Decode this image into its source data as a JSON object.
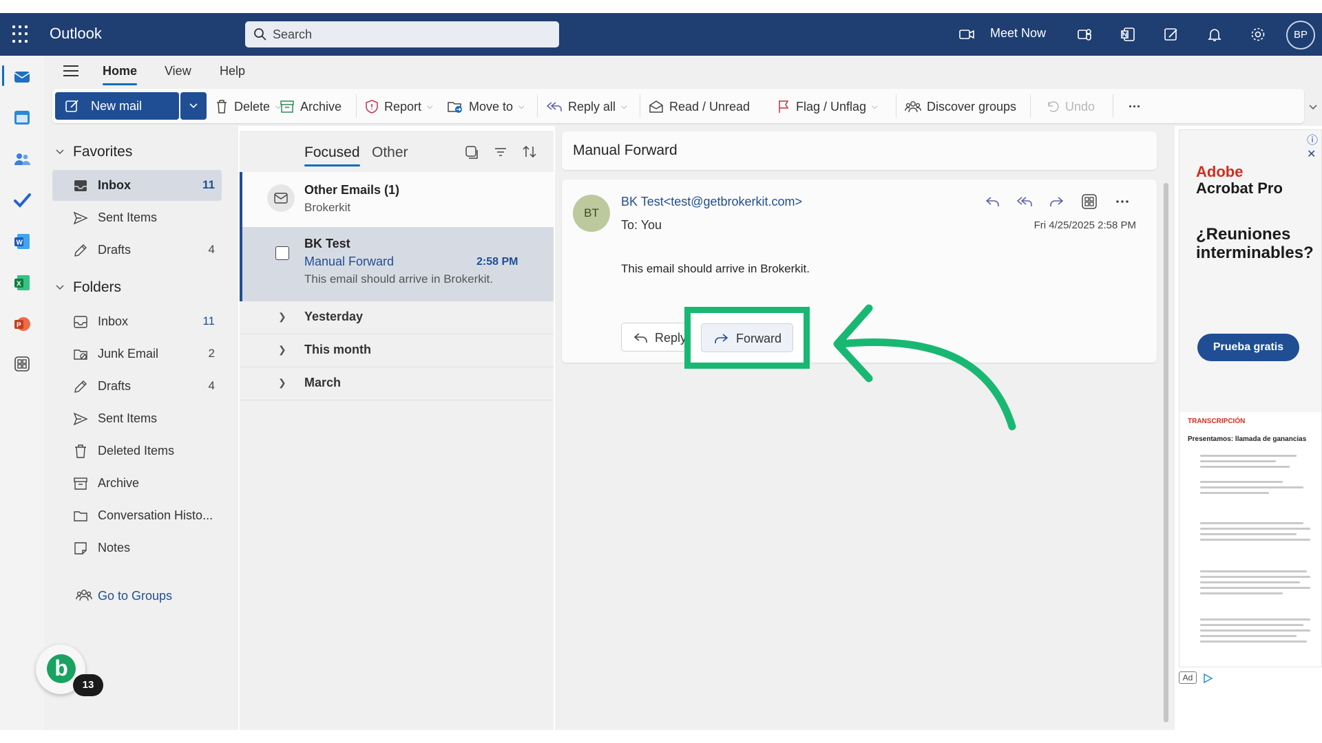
{
  "header": {
    "app_name": "Outlook",
    "search_placeholder": "Search",
    "meet_now": "Meet Now",
    "avatar_initials": "BP"
  },
  "menubar": {
    "tabs": [
      {
        "label": "Home",
        "active": true
      },
      {
        "label": "View",
        "active": false
      },
      {
        "label": "Help",
        "active": false
      }
    ]
  },
  "ribbon": {
    "new_mail": "New mail",
    "delete": "Delete",
    "archive": "Archive",
    "report": "Report",
    "move_to": "Move to",
    "reply_all": "Reply all",
    "read_unread": "Read / Unread",
    "flag_unflag": "Flag / Unflag",
    "discover_groups": "Discover groups",
    "undo": "Undo",
    "more": "···"
  },
  "folders": {
    "favorites_label": "Favorites",
    "favorites": [
      {
        "name": "Inbox",
        "count": "11",
        "icon": "inbox-icon",
        "selected": true
      },
      {
        "name": "Sent Items",
        "count": "",
        "icon": "send-icon",
        "selected": false
      },
      {
        "name": "Drafts",
        "count": "4",
        "icon": "pencil-icon",
        "selected": false
      }
    ],
    "folders_label": "Folders",
    "folders": [
      {
        "name": "Inbox",
        "count": "11",
        "icon": "inbox-icon"
      },
      {
        "name": "Junk Email",
        "count": "2",
        "icon": "junk-icon"
      },
      {
        "name": "Drafts",
        "count": "4",
        "icon": "pencil-icon"
      },
      {
        "name": "Sent Items",
        "count": "",
        "icon": "send-icon"
      },
      {
        "name": "Deleted Items",
        "count": "",
        "icon": "trash-icon"
      },
      {
        "name": "Archive",
        "count": "",
        "icon": "archive-icon"
      },
      {
        "name": "Conversation Histo...",
        "count": "",
        "icon": "folder-icon"
      },
      {
        "name": "Notes",
        "count": "",
        "icon": "note-icon"
      }
    ],
    "go_to_groups": "Go to Groups",
    "brokerkit_badge": "13"
  },
  "message_list": {
    "tab_focused": "Focused",
    "tab_other": "Other",
    "other_row": {
      "title": "Other Emails (1)",
      "subtitle": "Brokerkit"
    },
    "selected_row": {
      "sender": "BK Test",
      "subject": "Manual Forward",
      "time": "2:58 PM",
      "preview": "This email should arrive in Brokerkit."
    },
    "groups": [
      "Yesterday",
      "This month",
      "March"
    ]
  },
  "reading_pane": {
    "subject": "Manual Forward",
    "avatar_initials": "BT",
    "sender": "BK Test<test@getbrokerkit.com>",
    "to_line": "To:  You",
    "date": "Fri 4/25/2025 2:58 PM",
    "body": "This email should arrive in Brokerkit.",
    "reply_label": "Reply",
    "forward_label": "Forward"
  },
  "ad": {
    "brand_line1": "Adobe",
    "brand_line2": "Acrobat Pro",
    "headline": "¿Reuniones interminables?",
    "cta": "Prueba gratis",
    "doc_label": "TRANSCRIPCIÓN",
    "doc_title": "Presentamos: llamada de ganancias",
    "ad_mark": "Ad"
  },
  "colors": {
    "header_bg": "#1f3e72",
    "accent": "#1f4e94",
    "highlight_green": "#18b873",
    "selection_bg": "#d6dbe3"
  }
}
